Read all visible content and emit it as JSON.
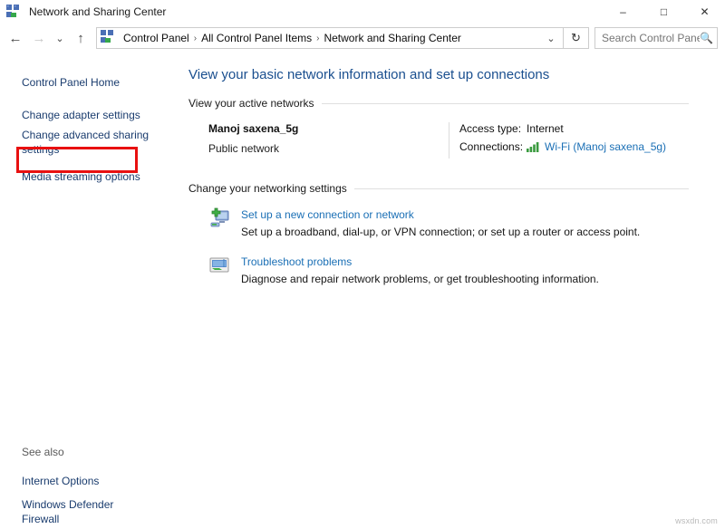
{
  "window": {
    "title": "Network and Sharing Center",
    "title_icon": "network-sharing-icon",
    "controls": {
      "minimize": "–",
      "maximize": "□",
      "close": "✕"
    }
  },
  "navbar": {
    "back_icon": "←",
    "forward_icon": "→",
    "recent_icon": "⌄",
    "up_icon": "↑",
    "address_icon": "network-sharing-icon",
    "breadcrumbs": [
      "Control Panel",
      "All Control Panel Items",
      "Network and Sharing Center"
    ],
    "separator": "›",
    "dropdown_icon": "⌄",
    "refresh_icon": "↻",
    "search": {
      "placeholder": "Search Control Panel",
      "value": "",
      "icon": "search-icon"
    }
  },
  "sidebar": {
    "home_label": "Control Panel Home",
    "items": [
      {
        "label": "Change adapter settings",
        "highlighted": true
      },
      {
        "label": "Change advanced sharing settings",
        "highlighted": false
      },
      {
        "label": "Media streaming options",
        "highlighted": false
      }
    ],
    "highlight_color": "#e81010",
    "see_also": {
      "title": "See also",
      "items": [
        {
          "label": "Internet Options"
        },
        {
          "label": "Windows Defender Firewall"
        }
      ]
    }
  },
  "main": {
    "heading": "View your basic network information and set up connections",
    "active_networks": {
      "section_label": "View your active networks",
      "network_name": "Manoj saxena_5g",
      "network_type": "Public network",
      "details": [
        {
          "key": "Access type:",
          "value": "Internet",
          "is_link": false,
          "icon": ""
        },
        {
          "key": "Connections:",
          "value": "Wi-Fi (Manoj saxena_5g)",
          "is_link": true,
          "icon": "wifi-signal-icon"
        }
      ]
    },
    "change_settings": {
      "section_label": "Change your networking settings",
      "items": [
        {
          "icon": "new-connection-icon",
          "title": "Set up a new connection or network",
          "description": "Set up a broadband, dial-up, or VPN connection; or set up a router or access point."
        },
        {
          "icon": "troubleshoot-icon",
          "title": "Troubleshoot problems",
          "description": "Diagnose and repair network problems, or get troubleshooting information."
        }
      ]
    }
  },
  "watermark": "wsxdn.com"
}
